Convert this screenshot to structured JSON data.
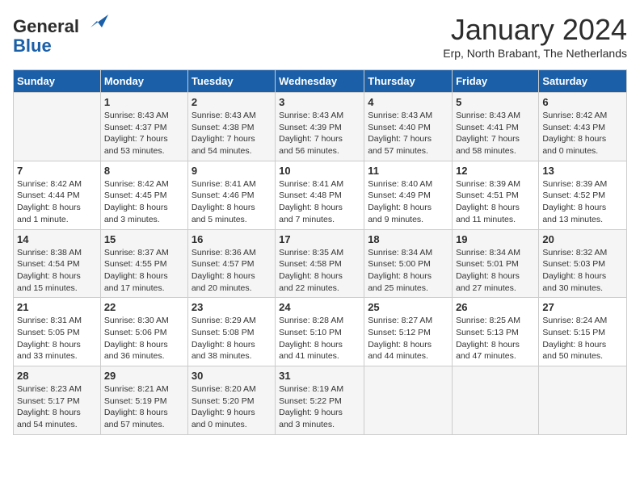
{
  "header": {
    "logo_general": "General",
    "logo_blue": "Blue",
    "month_title": "January 2024",
    "subtitle": "Erp, North Brabant, The Netherlands"
  },
  "days_of_week": [
    "Sunday",
    "Monday",
    "Tuesday",
    "Wednesday",
    "Thursday",
    "Friday",
    "Saturday"
  ],
  "weeks": [
    [
      {
        "day": "",
        "info": ""
      },
      {
        "day": "1",
        "info": "Sunrise: 8:43 AM\nSunset: 4:37 PM\nDaylight: 7 hours\nand 53 minutes."
      },
      {
        "day": "2",
        "info": "Sunrise: 8:43 AM\nSunset: 4:38 PM\nDaylight: 7 hours\nand 54 minutes."
      },
      {
        "day": "3",
        "info": "Sunrise: 8:43 AM\nSunset: 4:39 PM\nDaylight: 7 hours\nand 56 minutes."
      },
      {
        "day": "4",
        "info": "Sunrise: 8:43 AM\nSunset: 4:40 PM\nDaylight: 7 hours\nand 57 minutes."
      },
      {
        "day": "5",
        "info": "Sunrise: 8:43 AM\nSunset: 4:41 PM\nDaylight: 7 hours\nand 58 minutes."
      },
      {
        "day": "6",
        "info": "Sunrise: 8:42 AM\nSunset: 4:43 PM\nDaylight: 8 hours\nand 0 minutes."
      }
    ],
    [
      {
        "day": "7",
        "info": "Sunrise: 8:42 AM\nSunset: 4:44 PM\nDaylight: 8 hours\nand 1 minute."
      },
      {
        "day": "8",
        "info": "Sunrise: 8:42 AM\nSunset: 4:45 PM\nDaylight: 8 hours\nand 3 minutes."
      },
      {
        "day": "9",
        "info": "Sunrise: 8:41 AM\nSunset: 4:46 PM\nDaylight: 8 hours\nand 5 minutes."
      },
      {
        "day": "10",
        "info": "Sunrise: 8:41 AM\nSunset: 4:48 PM\nDaylight: 8 hours\nand 7 minutes."
      },
      {
        "day": "11",
        "info": "Sunrise: 8:40 AM\nSunset: 4:49 PM\nDaylight: 8 hours\nand 9 minutes."
      },
      {
        "day": "12",
        "info": "Sunrise: 8:39 AM\nSunset: 4:51 PM\nDaylight: 8 hours\nand 11 minutes."
      },
      {
        "day": "13",
        "info": "Sunrise: 8:39 AM\nSunset: 4:52 PM\nDaylight: 8 hours\nand 13 minutes."
      }
    ],
    [
      {
        "day": "14",
        "info": "Sunrise: 8:38 AM\nSunset: 4:54 PM\nDaylight: 8 hours\nand 15 minutes."
      },
      {
        "day": "15",
        "info": "Sunrise: 8:37 AM\nSunset: 4:55 PM\nDaylight: 8 hours\nand 17 minutes."
      },
      {
        "day": "16",
        "info": "Sunrise: 8:36 AM\nSunset: 4:57 PM\nDaylight: 8 hours\nand 20 minutes."
      },
      {
        "day": "17",
        "info": "Sunrise: 8:35 AM\nSunset: 4:58 PM\nDaylight: 8 hours\nand 22 minutes."
      },
      {
        "day": "18",
        "info": "Sunrise: 8:34 AM\nSunset: 5:00 PM\nDaylight: 8 hours\nand 25 minutes."
      },
      {
        "day": "19",
        "info": "Sunrise: 8:34 AM\nSunset: 5:01 PM\nDaylight: 8 hours\nand 27 minutes."
      },
      {
        "day": "20",
        "info": "Sunrise: 8:32 AM\nSunset: 5:03 PM\nDaylight: 8 hours\nand 30 minutes."
      }
    ],
    [
      {
        "day": "21",
        "info": "Sunrise: 8:31 AM\nSunset: 5:05 PM\nDaylight: 8 hours\nand 33 minutes."
      },
      {
        "day": "22",
        "info": "Sunrise: 8:30 AM\nSunset: 5:06 PM\nDaylight: 8 hours\nand 36 minutes."
      },
      {
        "day": "23",
        "info": "Sunrise: 8:29 AM\nSunset: 5:08 PM\nDaylight: 8 hours\nand 38 minutes."
      },
      {
        "day": "24",
        "info": "Sunrise: 8:28 AM\nSunset: 5:10 PM\nDaylight: 8 hours\nand 41 minutes."
      },
      {
        "day": "25",
        "info": "Sunrise: 8:27 AM\nSunset: 5:12 PM\nDaylight: 8 hours\nand 44 minutes."
      },
      {
        "day": "26",
        "info": "Sunrise: 8:25 AM\nSunset: 5:13 PM\nDaylight: 8 hours\nand 47 minutes."
      },
      {
        "day": "27",
        "info": "Sunrise: 8:24 AM\nSunset: 5:15 PM\nDaylight: 8 hours\nand 50 minutes."
      }
    ],
    [
      {
        "day": "28",
        "info": "Sunrise: 8:23 AM\nSunset: 5:17 PM\nDaylight: 8 hours\nand 54 minutes."
      },
      {
        "day": "29",
        "info": "Sunrise: 8:21 AM\nSunset: 5:19 PM\nDaylight: 8 hours\nand 57 minutes."
      },
      {
        "day": "30",
        "info": "Sunrise: 8:20 AM\nSunset: 5:20 PM\nDaylight: 9 hours\nand 0 minutes."
      },
      {
        "day": "31",
        "info": "Sunrise: 8:19 AM\nSunset: 5:22 PM\nDaylight: 9 hours\nand 3 minutes."
      },
      {
        "day": "",
        "info": ""
      },
      {
        "day": "",
        "info": ""
      },
      {
        "day": "",
        "info": ""
      }
    ]
  ]
}
